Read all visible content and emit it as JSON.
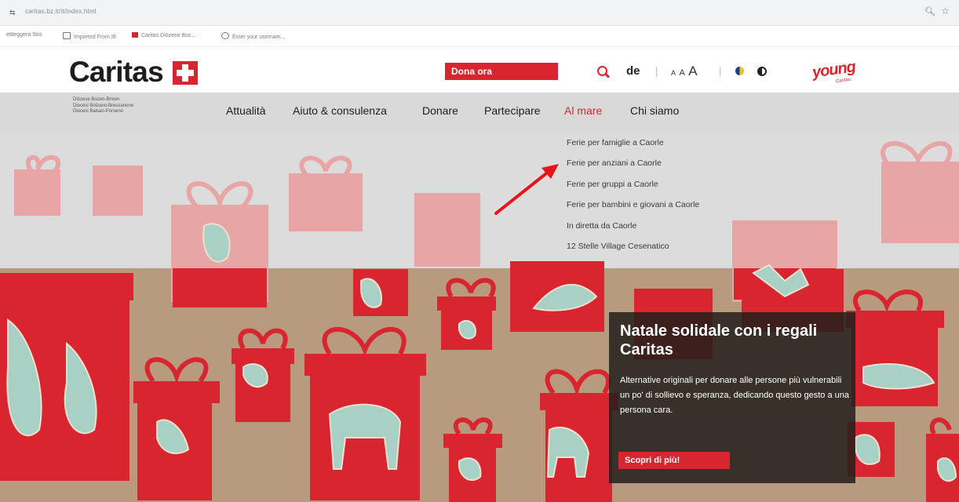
{
  "browser": {
    "url": "caritas.bz.it/it/index.html",
    "bookmarks": [
      {
        "label": "ettleggera Sito",
        "icon": "none"
      },
      {
        "label": "Imported From IE",
        "icon": "folder-icon"
      },
      {
        "label": "Caritas Diözese Boz...",
        "icon": "caritas-icon"
      },
      {
        "label": "Enter your usernam...",
        "icon": "globe-icon"
      }
    ]
  },
  "header": {
    "logo_text": "Caritas",
    "donate_label": "Dona ora",
    "lang": "de",
    "sep": "|",
    "font_small": "A",
    "font_medium": "A",
    "font_large": "A",
    "young_logo": "young",
    "young_sub": "Caritas"
  },
  "nav": {
    "diocese_lines": [
      "Diözese Bozen-Brixen",
      "Diocesi Bolzano-Bressanone",
      "Diocesi Balsan-Porsenù"
    ],
    "items": [
      {
        "label": "Attualità",
        "active": false
      },
      {
        "label": "Aiuto & consulenza",
        "active": false
      },
      {
        "label": "Donare",
        "active": false
      },
      {
        "label": "Partecipare",
        "active": false
      },
      {
        "label": "Al mare",
        "active": true
      },
      {
        "label": "Chi siamo",
        "active": false
      }
    ]
  },
  "dropdown": {
    "items": [
      "Ferie per famiglie a Caorle",
      "Ferie per anziani a Caorle",
      "Ferie per gruppi a Caorle",
      "Ferie per bambini e giovani a Caorle",
      "In diretta da Caorle",
      "12 Stelle Village Cesenatico"
    ]
  },
  "promo": {
    "title": "Natale solidale con i regali Caritas",
    "description": "Alternative originali per donare alle persone più vulnerabili un po' di sollievo e speranza, dedicando questo gesto a una persona cara.",
    "button_label": "Scopri di più!"
  },
  "colors": {
    "brand_red": "#d8252f",
    "nav_bg": "#d9d9d9",
    "hero_brown": "#b89b7e",
    "annotation_red": "#e8141b"
  }
}
